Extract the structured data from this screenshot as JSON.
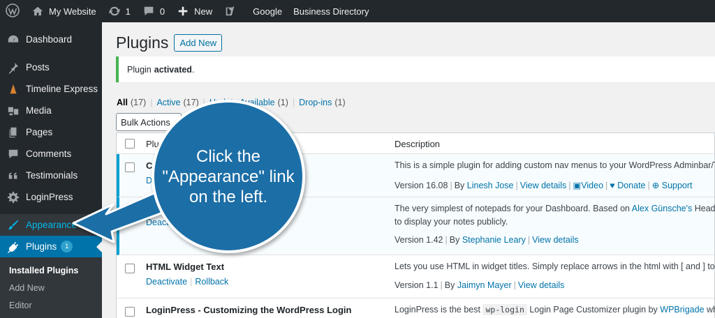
{
  "adminbar": {
    "site_name": "My Website",
    "updates_count": "1",
    "comments_count": "0",
    "new_label": "New",
    "google_label": "Google",
    "business_directory_label": "Business Directory"
  },
  "sidebar": {
    "items": [
      {
        "label": "Dashboard",
        "icon": "dashboard-icon"
      },
      {
        "label": "Posts",
        "icon": "pushpin-icon"
      },
      {
        "label": "Timeline Express",
        "icon": "timeline-icon"
      },
      {
        "label": "Media",
        "icon": "media-icon"
      },
      {
        "label": "Pages",
        "icon": "pages-icon"
      },
      {
        "label": "Comments",
        "icon": "comments-icon"
      },
      {
        "label": "Testimonials",
        "icon": "quote-icon"
      },
      {
        "label": "LoginPress",
        "icon": "gear-icon"
      },
      {
        "label": "Appearance",
        "icon": "paintbrush-icon"
      },
      {
        "label": "Plugins",
        "icon": "plugin-icon",
        "badge": "1"
      }
    ],
    "submenu": [
      "Installed Plugins",
      "Add New",
      "Editor"
    ]
  },
  "main": {
    "title": "Plugins",
    "add_new_label": "Add New",
    "notice_prefix": "Plugin",
    "notice_bold": "activated",
    "notice_suffix": ".",
    "filters": [
      {
        "label": "All",
        "count": "(17)"
      },
      {
        "label": "Active",
        "count": "(17)"
      },
      {
        "label": "Update Available",
        "count": "(1)"
      },
      {
        "label": "Drop-ins",
        "count": "(1)"
      }
    ],
    "bulk_actions_label": "Bulk Actions",
    "col_plugin": "Plugin",
    "col_description": "Description",
    "rows": [
      {
        "title": "Cu",
        "action1": "Deacti",
        "description": "This is a simple plugin for adding custom nav menus to your WordPress Adminbar/Toolba",
        "version": "Version 16.08",
        "by": "By",
        "author": "Linesh Jose",
        "view_details": "View details",
        "video": "Video",
        "donate": "Donate",
        "support": "Support"
      },
      {
        "action1": "Deactiv",
        "description_a": "The very simplest of notepads for your Dashboard. Based on",
        "description_link": "Alex Günsche's",
        "description_b": "Headache W",
        "description_line2": "to display your notes publicly.",
        "version": "Version 1.42",
        "by": "By",
        "author": "Stephanie Leary",
        "view_details": "View details"
      },
      {
        "title": "HTML Widget Text",
        "action1": "Deactivate",
        "action2": "Rollback",
        "description": "Lets you use HTML in widget titles. Simply replace arrows in the html with [ and ] to use.",
        "version": "Version 1.1",
        "by": "By",
        "author": "Jaimyn Mayer",
        "view_details": "View details"
      },
      {
        "title": "LoginPress - Customizing the WordPress Login",
        "description_a": "LoginPress is the best",
        "description_code": "wp-login",
        "description_b": "Login Page Customizer plugin by",
        "description_link": "WPBrigade",
        "description_c": "which all"
      }
    ]
  },
  "callout": {
    "line1": "Click the",
    "line2": "\"Appearance\" link",
    "line3": "on the left.",
    "color": "#1a6ea6"
  }
}
